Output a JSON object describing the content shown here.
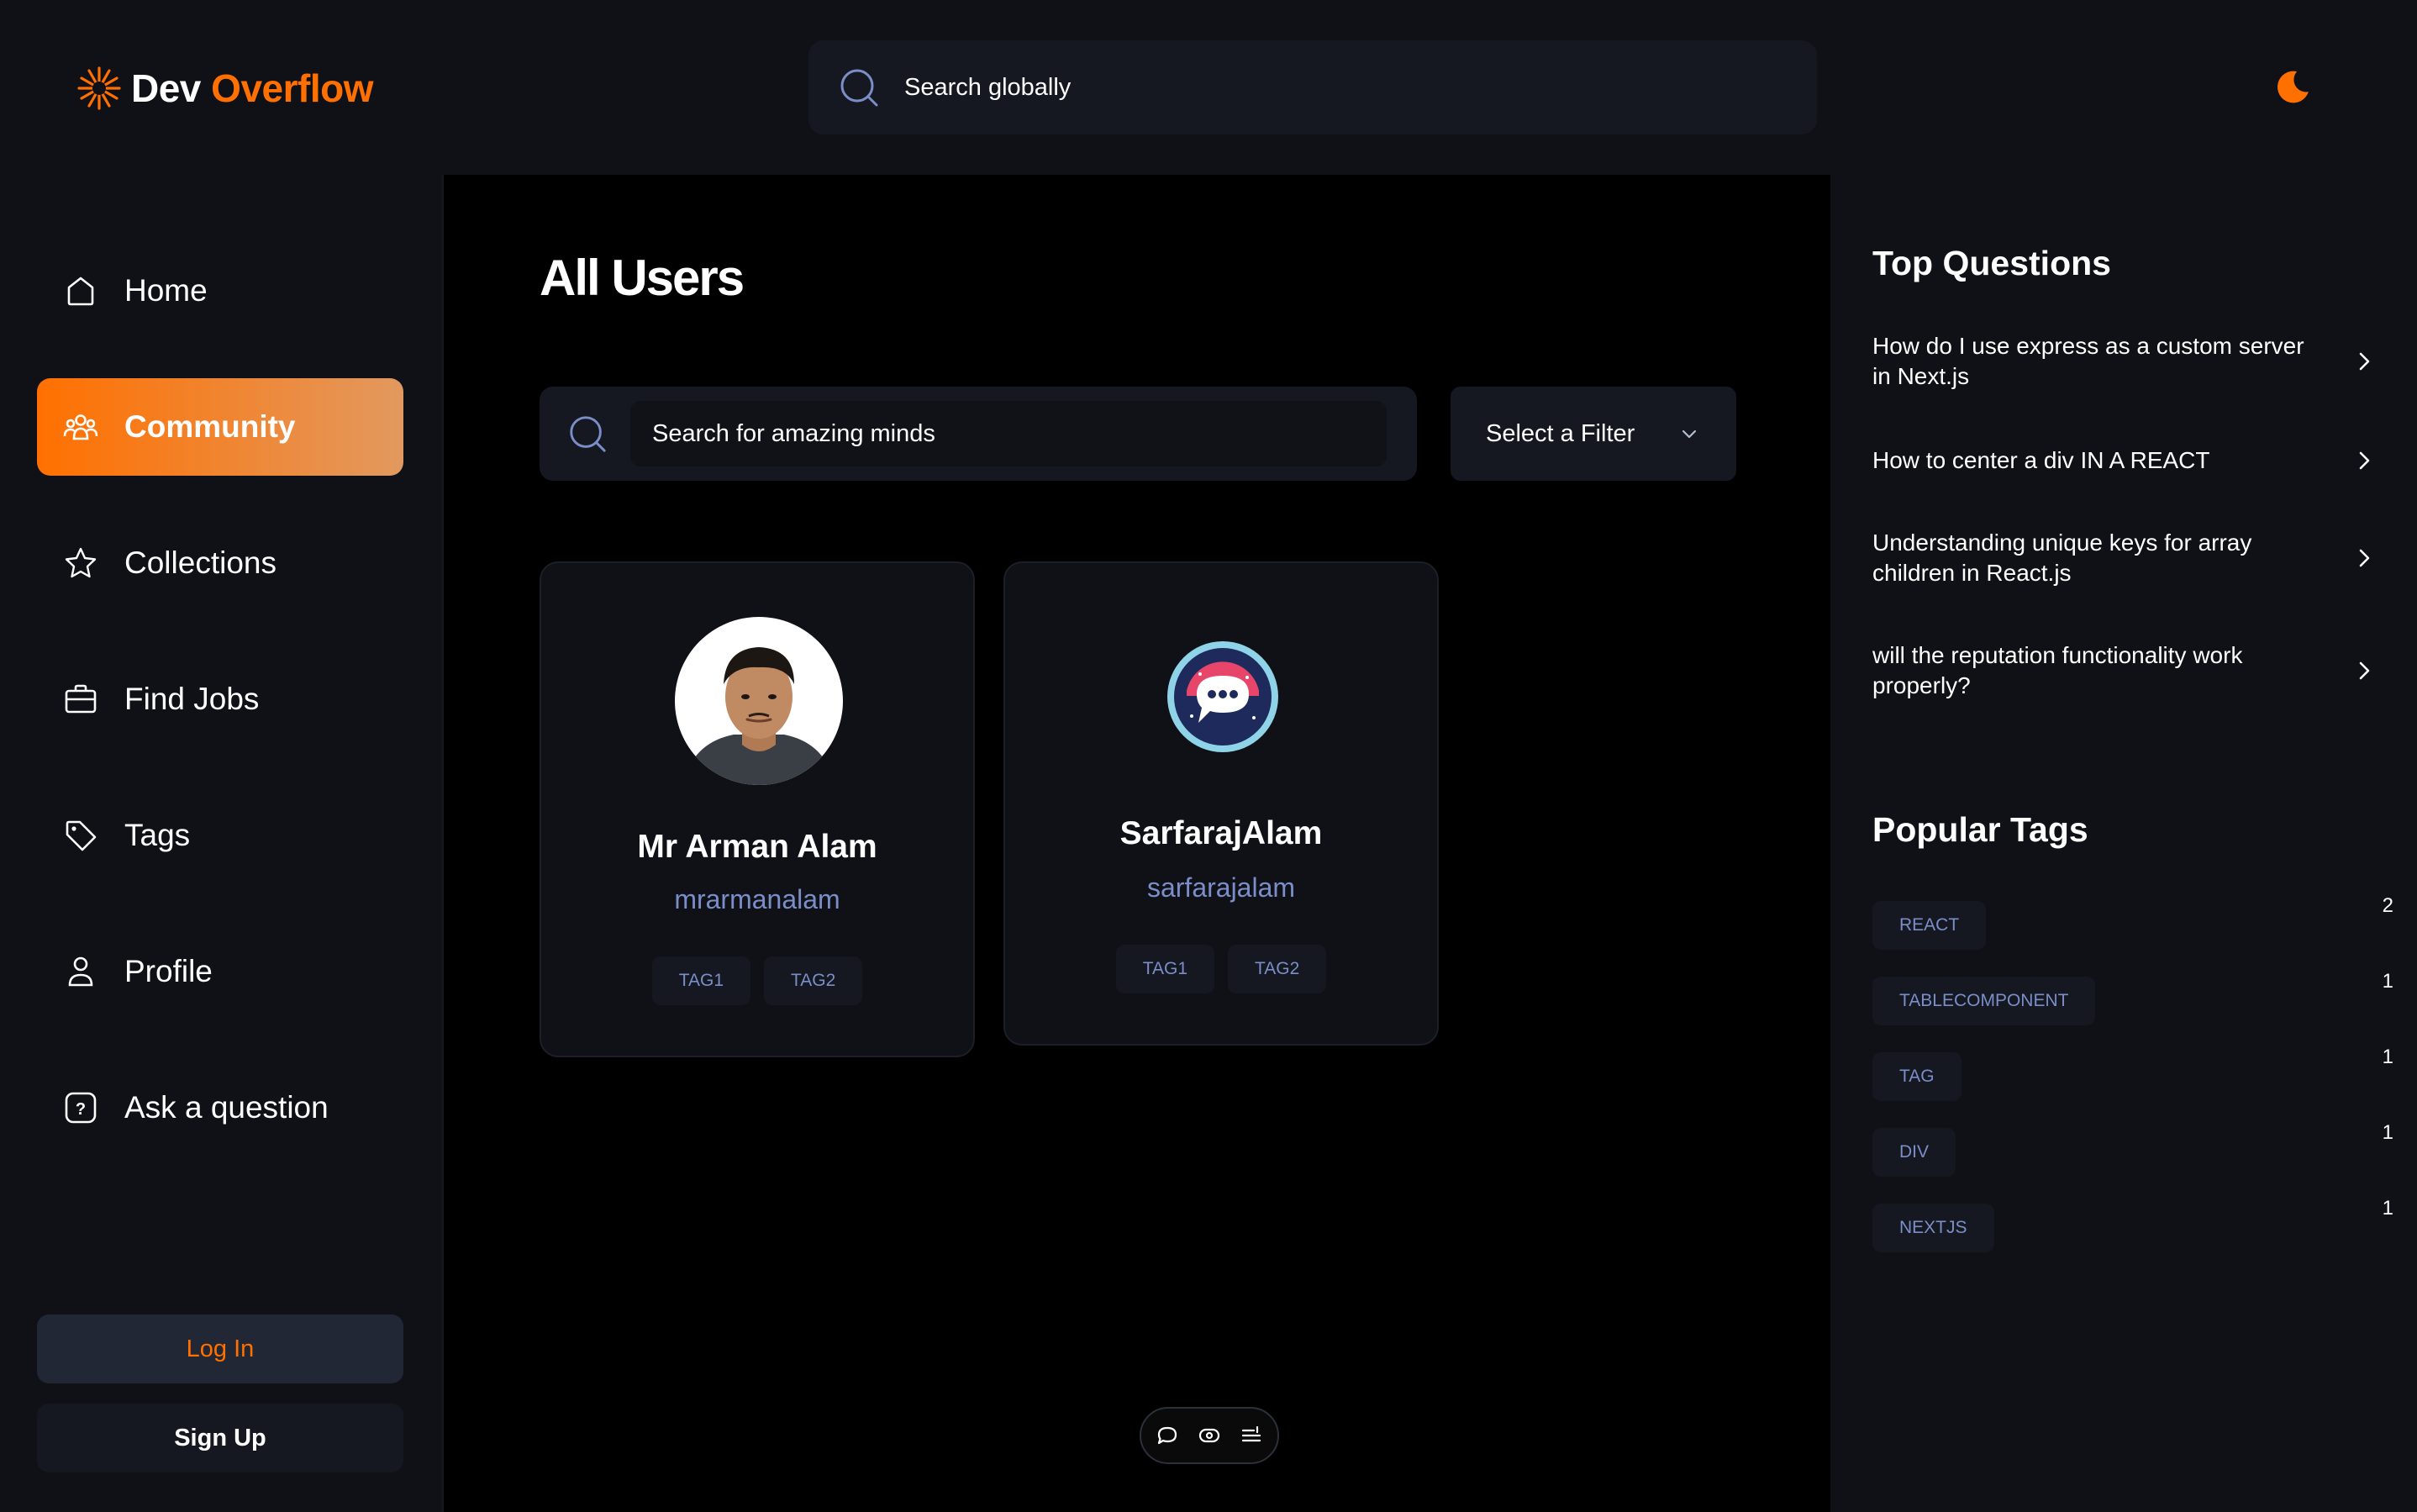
{
  "header": {
    "logo_dev": "Dev",
    "logo_overflow": "Overflow",
    "search_placeholder": "Search globally",
    "theme_icon": "moon-icon"
  },
  "colors": {
    "accent": "#ff7000",
    "accent_gradient_end": "#e2995f",
    "panel": "#0f1117",
    "surface": "#151821",
    "tag_text": "#7b8ec8"
  },
  "sidebar": {
    "items": [
      {
        "label": "Home",
        "icon": "home-icon",
        "active": false
      },
      {
        "label": "Community",
        "icon": "users-icon",
        "active": true
      },
      {
        "label": "Collections",
        "icon": "star-icon",
        "active": false
      },
      {
        "label": "Find Jobs",
        "icon": "briefcase-icon",
        "active": false
      },
      {
        "label": "Tags",
        "icon": "tag-icon",
        "active": false
      },
      {
        "label": "Profile",
        "icon": "user-icon",
        "active": false
      },
      {
        "label": "Ask a question",
        "icon": "question-icon",
        "active": false
      }
    ],
    "login_label": "Log In",
    "signup_label": "Sign Up"
  },
  "main": {
    "title": "All Users",
    "search_placeholder": "Search for amazing minds",
    "filter_label": "Select a Filter",
    "users": [
      {
        "name": "Mr Arman Alam",
        "username": "mrarmanalam",
        "tags": [
          "TAG1",
          "TAG2"
        ]
      },
      {
        "name": "SarfarajAlam",
        "username": "sarfarajalam",
        "tags": [
          "TAG1",
          "TAG2"
        ]
      }
    ],
    "toolbar_icons": [
      "comment-icon",
      "eye-icon",
      "list-icon"
    ]
  },
  "right_sidebar": {
    "top_questions_title": "Top Questions",
    "questions": [
      "How do I use express as a custom server in Next.js",
      "How to center a div IN A REACT",
      "Understanding unique keys for array children in React.js",
      "will the reputation functionality work properly?"
    ],
    "popular_tags_title": "Popular Tags",
    "tags": [
      {
        "name": "REACT",
        "count": "2"
      },
      {
        "name": "TABLECOMPONENT",
        "count": "1"
      },
      {
        "name": "TAG",
        "count": "1"
      },
      {
        "name": "DIV",
        "count": "1"
      },
      {
        "name": "NEXTJS",
        "count": "1"
      }
    ]
  }
}
